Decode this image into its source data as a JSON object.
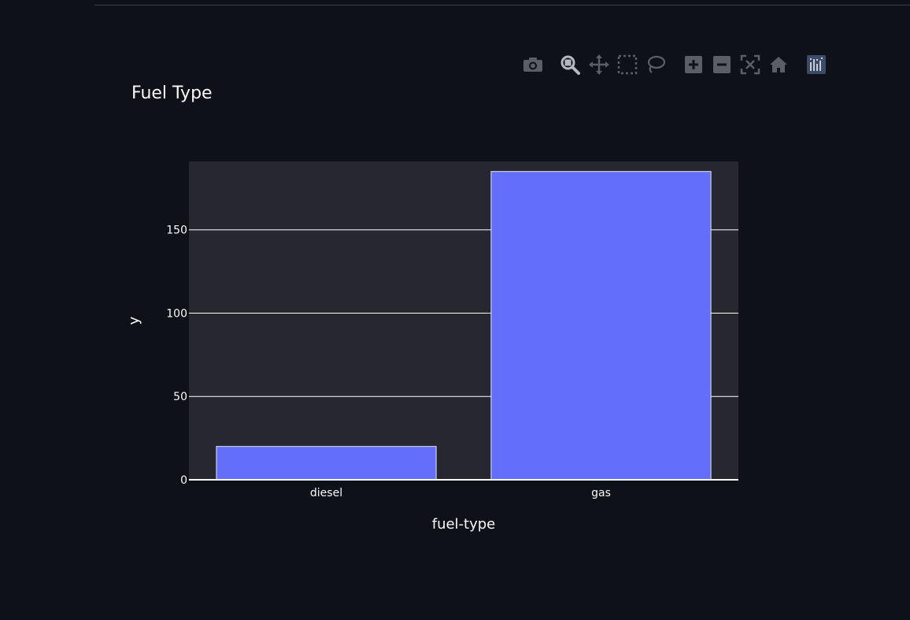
{
  "modebar": {
    "buttons": [
      {
        "icon": "camera-icon",
        "name": "download-plot-button"
      },
      {
        "icon": "zoom-icon",
        "name": "zoom-button",
        "active": true
      },
      {
        "icon": "pan-icon",
        "name": "pan-button"
      },
      {
        "icon": "box-select-icon",
        "name": "box-select-button"
      },
      {
        "icon": "lasso-icon",
        "name": "lasso-select-button"
      },
      {
        "icon": "zoom-in-icon",
        "name": "zoom-in-button"
      },
      {
        "icon": "zoom-out-icon",
        "name": "zoom-out-button"
      },
      {
        "icon": "autoscale-icon",
        "name": "autoscale-button"
      },
      {
        "icon": "home-icon",
        "name": "reset-axes-button"
      },
      {
        "icon": "plotly-logo-icon",
        "name": "plotly-logo"
      }
    ]
  },
  "chart_data": {
    "type": "bar",
    "title": "Fuel Type",
    "xlabel": "fuel-type",
    "ylabel": "y",
    "categories": [
      "diesel",
      "gas"
    ],
    "values": [
      20,
      185
    ],
    "ylim": [
      0,
      191
    ],
    "yticks": [
      0,
      50,
      100,
      150
    ],
    "grid": true,
    "legend": "none",
    "colors": {
      "bar": "#636efa",
      "bar_outline": "#e5e5f0",
      "plot_bg": "#262730",
      "paper_bg": "#0e1117",
      "grid": "#ffffff",
      "text": "#fafafa"
    }
  }
}
